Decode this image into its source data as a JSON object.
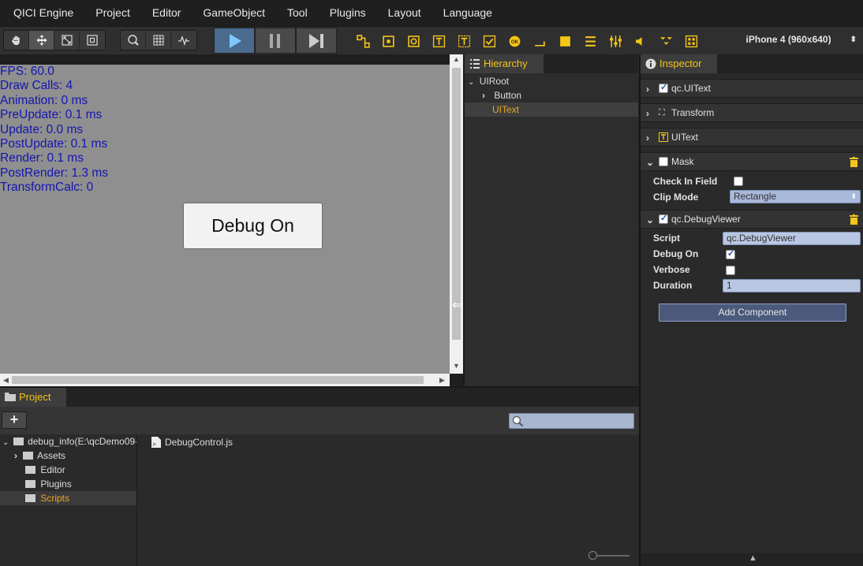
{
  "menu": [
    "QICI Engine",
    "Project",
    "Editor",
    "GameObject",
    "Tool",
    "Plugins",
    "Layout",
    "Language"
  ],
  "toolbar": {
    "transform_tools": [
      "hand-icon",
      "move-icon",
      "scale-icon",
      "rect-icon"
    ],
    "view_tools": [
      "zoom-icon",
      "grid-icon",
      "stats-icon"
    ],
    "playback": [
      "play-icon",
      "pause-icon",
      "step-icon"
    ],
    "widget_count": 14,
    "device": "iPhone 4 (960x640)",
    "accent": "#f5c518"
  },
  "scene": {
    "stats": [
      "FPS: 60.0",
      "Draw Calls: 4",
      "Animation: 0 ms",
      "PreUpdate: 0.1 ms",
      "Update: 0.0 ms",
      "PostUpdate: 0.1 ms",
      "Render: 0.1 ms",
      "PostRender: 1.3 ms",
      "TransformCalc: 0"
    ],
    "button_label": "Debug On"
  },
  "hierarchy": {
    "title": "Hierarchy",
    "root": "UIRoot",
    "items": [
      "Button",
      "UIText"
    ],
    "selected": "UIText"
  },
  "inspector": {
    "title": "Inspector",
    "components": {
      "uitext_header": "qc.UIText",
      "transform": "Transform",
      "uitext": "UIText",
      "mask": "Mask",
      "debugviewer": "qc.DebugViewer"
    },
    "mask": {
      "check_in_field_label": "Check In Field",
      "check_in_field": false,
      "clip_mode_label": "Clip Mode",
      "clip_mode": "Rectangle"
    },
    "debugviewer": {
      "script_label": "Script",
      "script": "qc.DebugViewer",
      "debug_on_label": "Debug On",
      "debug_on": true,
      "verbose_label": "Verbose",
      "verbose": false,
      "duration_label": "Duration",
      "duration": "1"
    },
    "add_component": "Add Component"
  },
  "project": {
    "title": "Project",
    "add_label": "+",
    "search_placeholder": "",
    "root": "debug_info(E:\\qcDemo09-",
    "folders": [
      "Assets",
      "Editor",
      "Plugins",
      "Scripts"
    ],
    "selected": "Scripts",
    "files": [
      "DebugControl.js"
    ]
  }
}
